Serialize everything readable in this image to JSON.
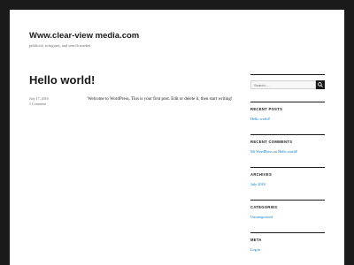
{
  "site": {
    "title": "Www.clear-view media.com",
    "description": "publicité, infogiaes, and search market"
  },
  "post": {
    "title": "Hello world!",
    "date": "July 17, 2016",
    "comments": "1 Comment",
    "content": "Welcome to WordPress. This is your first post. Edit or delete it, then start writing!"
  },
  "sidebar": {
    "search": {
      "placeholder": "Search …"
    },
    "recent_posts": {
      "title": "RECENT POSTS",
      "items": [
        "Hello world!"
      ]
    },
    "recent_comments": {
      "title": "RECENT COMMENTS",
      "author": "Mr WordPress",
      "on": "on",
      "post": "Hello world!"
    },
    "archives": {
      "title": "ARCHIVES",
      "items": [
        "July 2016"
      ]
    },
    "categories": {
      "title": "CATEGORIES",
      "items": [
        "Uncategorized"
      ]
    },
    "meta": {
      "title": "META",
      "items": [
        "Log in"
      ]
    }
  },
  "colors": {
    "link": "#007acc",
    "frame": "#1a1a1a",
    "text": "#1a1a1a",
    "muted": "#686868"
  }
}
